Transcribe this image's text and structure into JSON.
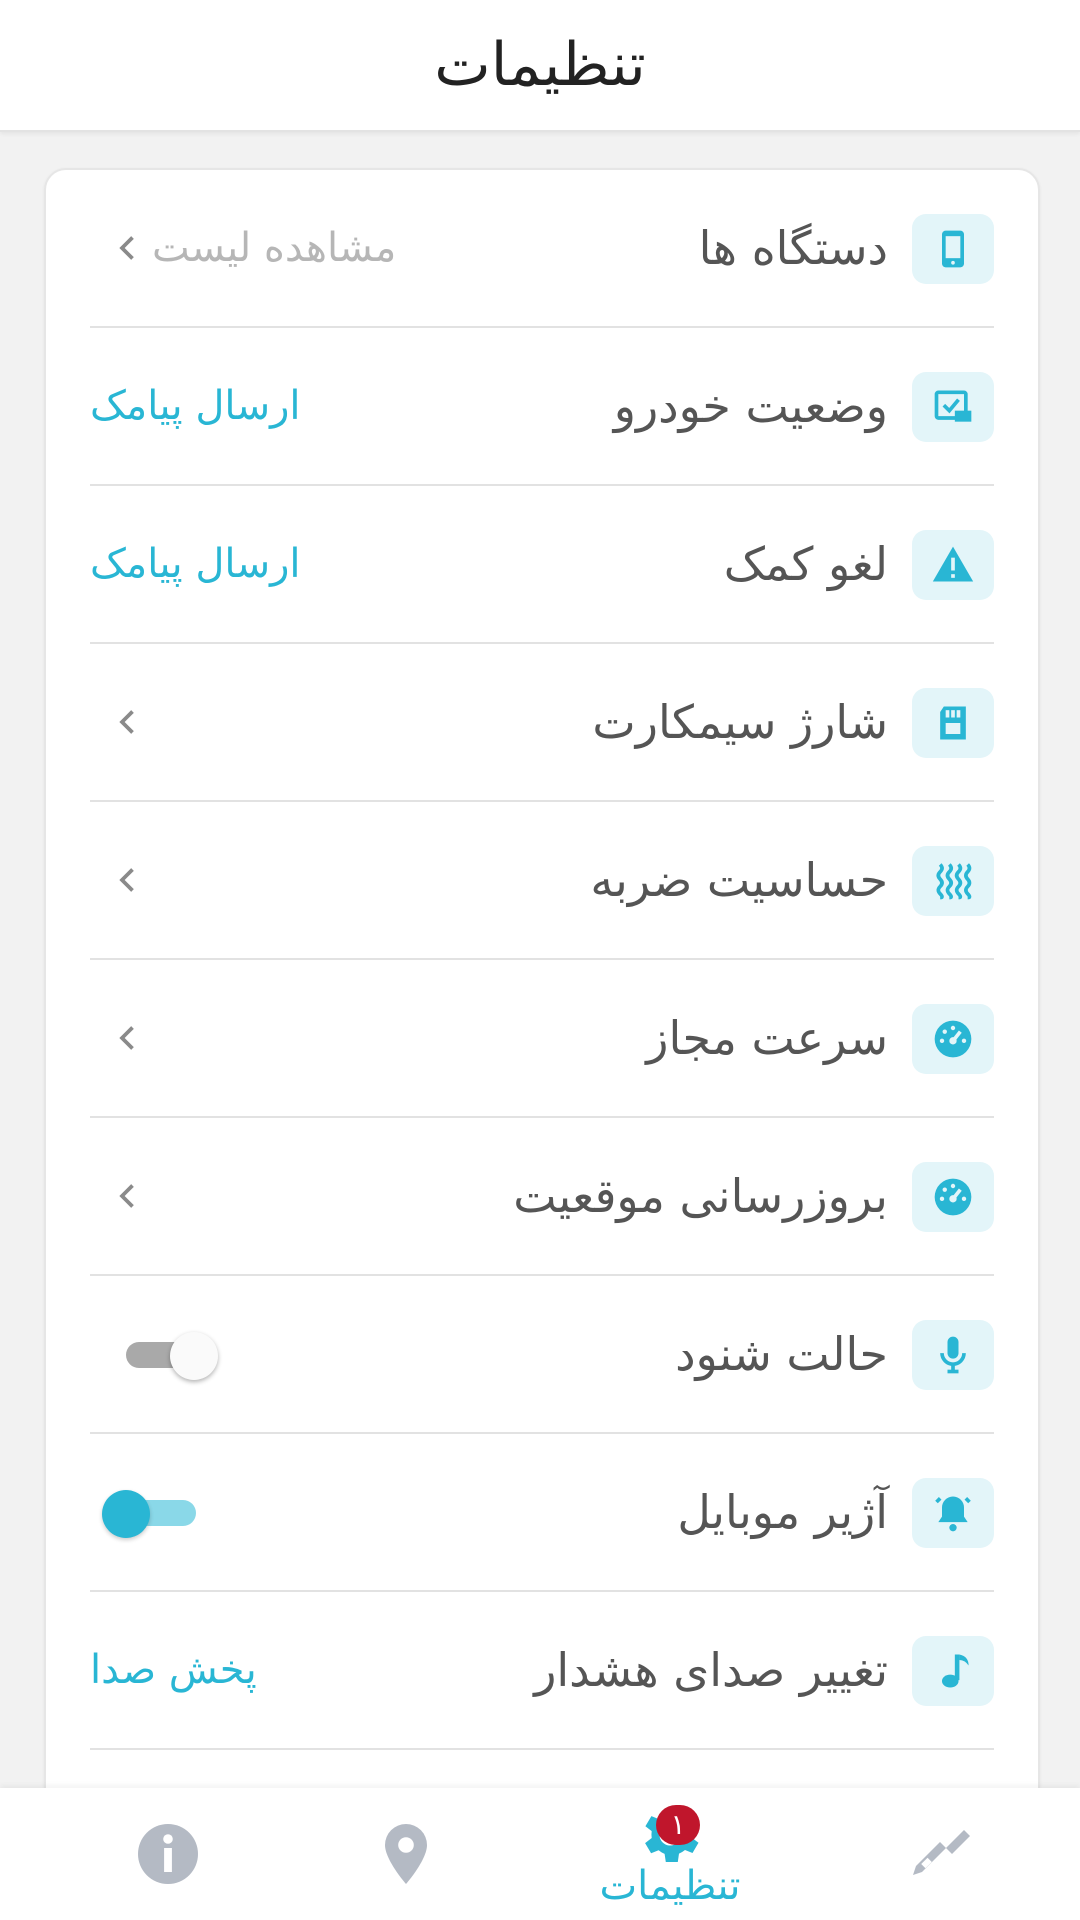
{
  "header": {
    "title": "تنظیمات"
  },
  "rows": [
    {
      "label": "دستگاه ها",
      "icon": "phone-icon",
      "action": "مشاهده لیست",
      "action_type": "chevron-muted"
    },
    {
      "label": "وضعیت خودرو",
      "icon": "vehicle-status-icon",
      "action": "ارسال پیامک",
      "action_type": "link"
    },
    {
      "label": "لغو کمک",
      "icon": "warning-icon",
      "action": "ارسال پیامک",
      "action_type": "link"
    },
    {
      "label": "شارژ سیمکارت",
      "icon": "sim-card-icon",
      "action_type": "chevron"
    },
    {
      "label": "حساسیت ضربه",
      "icon": "vibration-icon",
      "action_type": "chevron"
    },
    {
      "label": "سرعت مجاز",
      "icon": "speedometer-icon",
      "action_type": "chevron"
    },
    {
      "label": "بروزرسانی موقعیت",
      "icon": "speedometer-icon",
      "action_type": "chevron"
    },
    {
      "label": "حالت شنود",
      "icon": "microphone-icon",
      "action_type": "toggle",
      "toggle_on": false
    },
    {
      "label": "آژیر موبایل",
      "icon": "bell-icon",
      "action_type": "toggle",
      "toggle_on": true
    },
    {
      "label": "تغییر صدای هشدار",
      "icon": "music-note-icon",
      "action": "پخش صدا",
      "action_type": "link"
    }
  ],
  "bottom_nav": {
    "items": [
      {
        "icon": "info-icon",
        "active": false
      },
      {
        "icon": "location-pin-icon",
        "active": false
      },
      {
        "icon": "gear-icon",
        "label": "تنظیمات",
        "active": true,
        "badge": "۱"
      },
      {
        "icon": "car-key-icon",
        "active": false
      }
    ]
  },
  "colors": {
    "accent": "#29b6d4",
    "badge": "#c0162c",
    "icon_bg": "#e3f5f9",
    "inactive_icon": "#b4bac4"
  }
}
